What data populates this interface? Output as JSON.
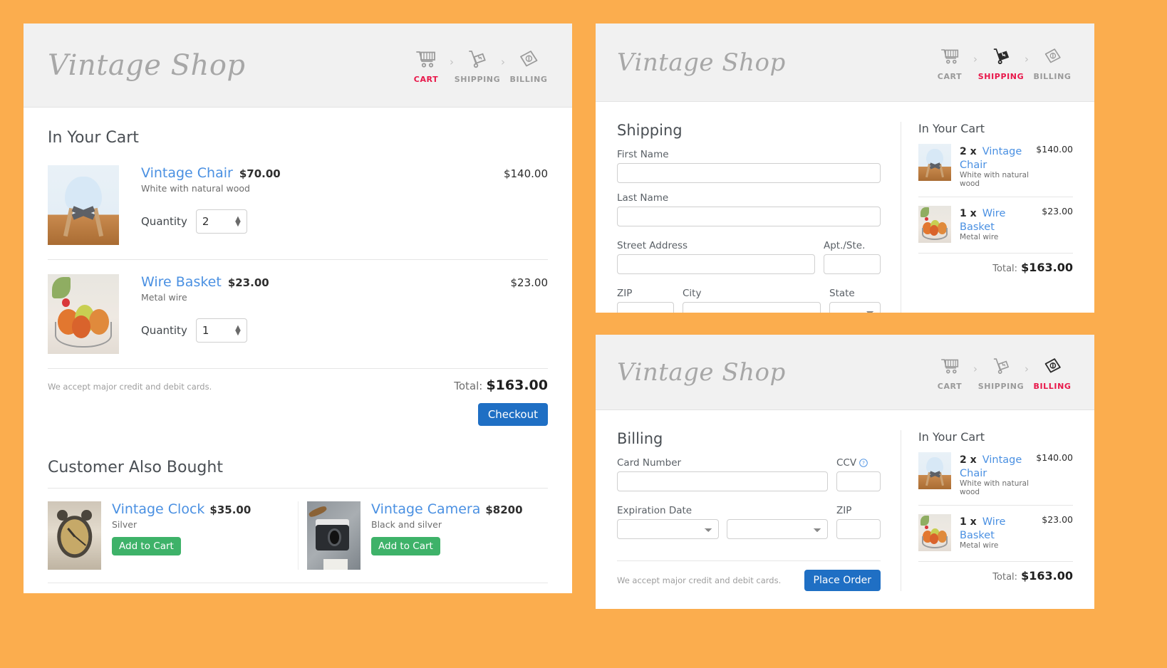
{
  "brand": {
    "name": "Vintage Shop",
    "accent_red": "#E8174A",
    "accent_blue": "#4a90e2",
    "page_background": "#FBAD4E"
  },
  "steps": {
    "cart": {
      "label": "CART",
      "icon": "shopping-cart-icon"
    },
    "shipping": {
      "label": "SHIPPING",
      "icon": "hand-truck-icon"
    },
    "billing": {
      "label": "BILLING",
      "icon": "money-bill-icon"
    },
    "separator": "›"
  },
  "cart_panel": {
    "title": "In Your Cart",
    "items": [
      {
        "name": "Vintage Chair",
        "unit_price": "$70.00",
        "description": "White with natural wood",
        "quantity_label": "Quantity",
        "quantity": "2",
        "line_total": "$140.00",
        "thumb": "chair-photo"
      },
      {
        "name": "Wire Basket",
        "unit_price": "$23.00",
        "description": "Metal wire",
        "quantity_label": "Quantity",
        "quantity": "1",
        "line_total": "$23.00",
        "thumb": "basket-photo"
      }
    ],
    "disclaimer": "We accept major credit and debit cards.",
    "total_label": "Total:",
    "total_value": "$163.00",
    "checkout_button": "Checkout",
    "also_bought": {
      "title": "Customer Also Bought",
      "items": [
        {
          "name": "Vintage Clock",
          "price": "$35.00",
          "description": "Silver",
          "button": "Add to Cart",
          "thumb": "clock-photo"
        },
        {
          "name": "Vintage Camera",
          "price": "$8200",
          "description": "Black and silver",
          "button": "Add to Cart",
          "thumb": "camera-photo"
        }
      ]
    }
  },
  "shipping_panel": {
    "title": "Shipping",
    "fields": {
      "first_name": {
        "label": "First Name",
        "value": ""
      },
      "last_name": {
        "label": "Last Name",
        "value": ""
      },
      "street_address": {
        "label": "Street Address",
        "value": ""
      },
      "apt": {
        "label": "Apt./Ste.",
        "value": ""
      },
      "zip": {
        "label": "ZIP",
        "value": ""
      },
      "city": {
        "label": "City",
        "value": ""
      },
      "state": {
        "label": "State",
        "value": ""
      }
    },
    "summary": {
      "title": "In Your Cart",
      "items": [
        {
          "qty": "2 x",
          "name": "Vintage Chair",
          "description": "White with natural wood",
          "price": "$140.00",
          "thumb": "chair-photo"
        },
        {
          "qty": "1 x",
          "name": "Wire Basket",
          "description": "Metal wire",
          "price": "$23.00",
          "thumb": "basket-photo"
        }
      ],
      "total_label": "Total:",
      "total_value": "$163.00"
    }
  },
  "billing_panel": {
    "title": "Billing",
    "fields": {
      "card_number": {
        "label": "Card Number",
        "value": ""
      },
      "ccv": {
        "label": "CCV",
        "value": "",
        "help_icon": "question-circle-icon"
      },
      "expiration_date": {
        "label": "Expiration Date",
        "month": "",
        "year": ""
      },
      "zip": {
        "label": "ZIP",
        "value": ""
      }
    },
    "disclaimer": "We accept major credit and debit cards.",
    "place_order_button": "Place Order",
    "summary": {
      "title": "In Your Cart",
      "items": [
        {
          "qty": "2 x",
          "name": "Vintage Chair",
          "description": "White with natural wood",
          "price": "$140.00",
          "thumb": "chair-photo"
        },
        {
          "qty": "1 x",
          "name": "Wire Basket",
          "description": "Metal wire",
          "price": "$23.00",
          "thumb": "basket-photo"
        }
      ],
      "total_label": "Total:",
      "total_value": "$163.00"
    }
  }
}
